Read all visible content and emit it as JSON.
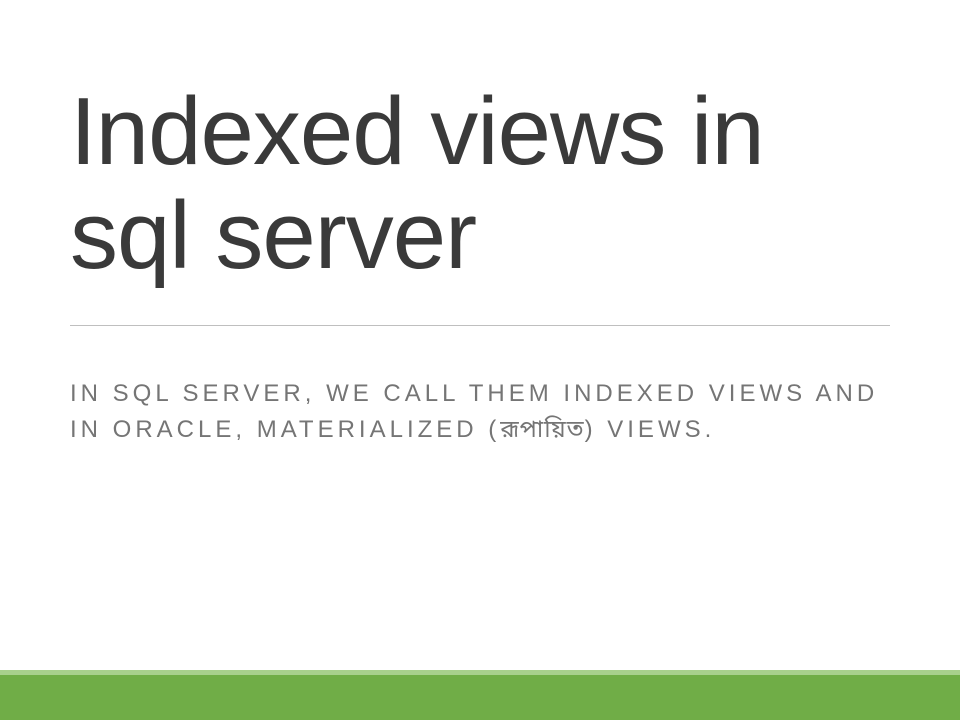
{
  "slide": {
    "title": "Indexed views in sql server",
    "subtitle_part1": "IN SQL SERVER, WE CALL THEM INDEXED VIEWS AND IN ORACLE, MATERIALIZED (",
    "subtitle_bengali": "রূপায়িত",
    "subtitle_part2": ") VIEWS.",
    "theme": {
      "accent_primary": "#70ad47",
      "accent_light": "#a8d08d",
      "text_title": "#3a3a3a",
      "text_subtitle": "#757575"
    }
  }
}
